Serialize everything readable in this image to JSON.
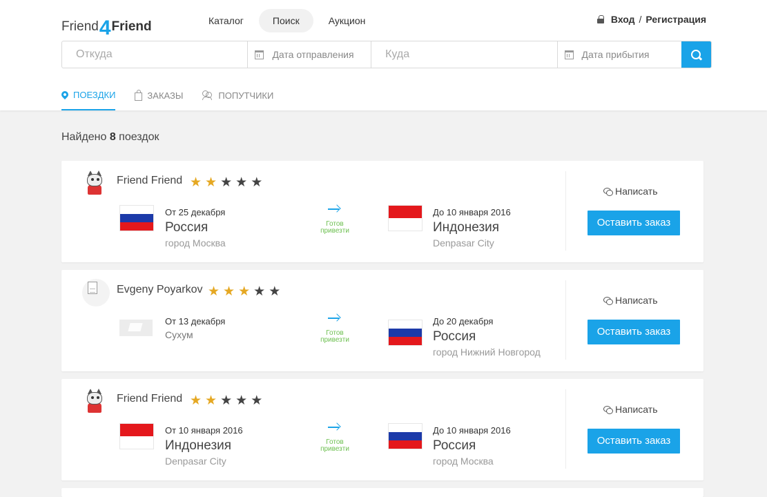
{
  "logo": {
    "part1": "Friend",
    "number": "4",
    "part2": "Friend"
  },
  "nav": [
    "Каталог",
    "Поиск",
    "Аукцион"
  ],
  "auth": {
    "login": "Вход",
    "separator": "/",
    "register": "Регистрация"
  },
  "search": {
    "from_placeholder": "Откуда",
    "depart_date_placeholder": "Дата отправления",
    "to_placeholder": "Куда",
    "arrive_date_placeholder": "Дата прибытия"
  },
  "tabs": [
    "ПОЕЗДКИ",
    "ЗАКАЗЫ",
    "ПОПУТЧИКИ"
  ],
  "found": {
    "prefix": "Найдено",
    "count": "8",
    "suffix": "поездок"
  },
  "trip_common": {
    "ready_line1": "Готов",
    "ready_line2": "привезти",
    "write_label": "Написать",
    "order_label": "Оставить заказ"
  },
  "trips": [
    {
      "user": "Friend Friend",
      "rating": 2,
      "avatar": "cat-avatar",
      "from": {
        "date": "От 25 декабря",
        "country": "Россия",
        "city": "город Москва",
        "flag": "russia-flag"
      },
      "to": {
        "date": "До 10 января 2016",
        "country": "Индонезия",
        "city": "Denpasar City",
        "flag": "indonesia-flag"
      }
    },
    {
      "user": "Evgeny Poyarkov",
      "rating": 3,
      "avatar": "placeholder-avatar",
      "from": {
        "date": "От 13 декабря",
        "country": "",
        "city": "Сухум",
        "flag": "placeholder-flag"
      },
      "to": {
        "date": "До 20 декабря",
        "country": "Россия",
        "city": "город Нижний Новгород",
        "flag": "russia-flag"
      }
    },
    {
      "user": "Friend Friend",
      "rating": 2,
      "avatar": "cat-avatar",
      "from": {
        "date": "От 10 января 2016",
        "country": "Индонезия",
        "city": "Denpasar City",
        "flag": "indonesia-flag"
      },
      "to": {
        "date": "До 10 января 2016",
        "country": "Россия",
        "city": "город Москва",
        "flag": "russia-flag"
      }
    }
  ],
  "colors": {
    "accent": "#1aa3e8",
    "star_on": "#e5a823",
    "star_off": "#444444",
    "ready": "#6bbf4e"
  }
}
